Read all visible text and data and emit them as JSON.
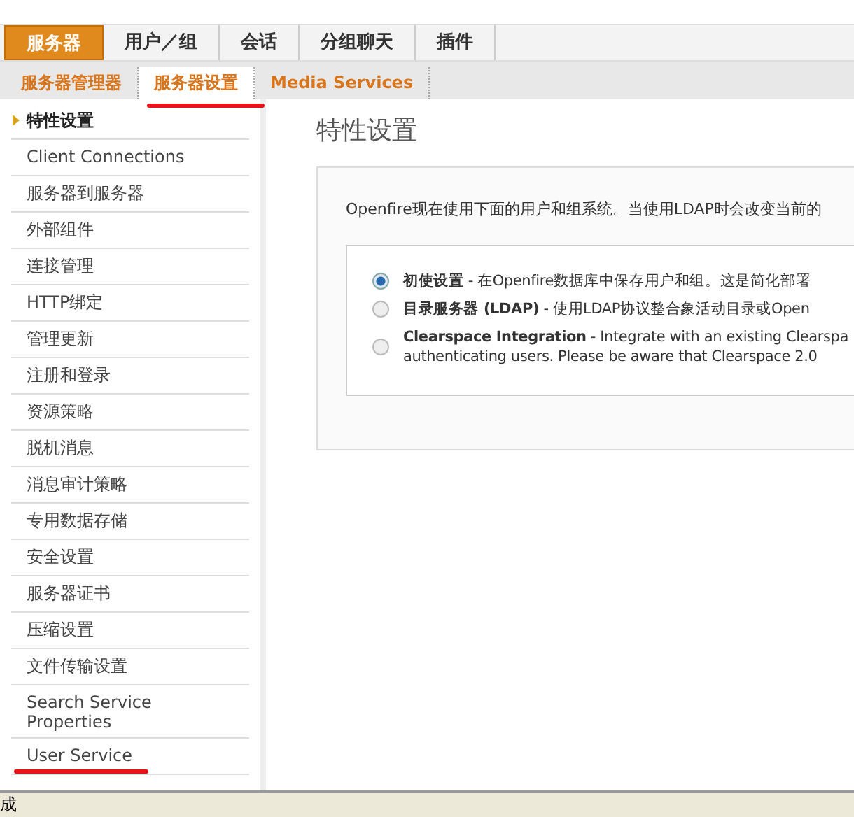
{
  "main_tabs": [
    {
      "label": "服务器",
      "selected": true
    },
    {
      "label": "用户／组",
      "selected": false
    },
    {
      "label": "会话",
      "selected": false
    },
    {
      "label": "分组聊天",
      "selected": false
    },
    {
      "label": "插件",
      "selected": false
    }
  ],
  "sub_tabs": [
    {
      "label": "服务器管理器",
      "selected": false,
      "underlined": false
    },
    {
      "label": "服务器设置",
      "selected": true,
      "underlined": true
    },
    {
      "label": "Media Services",
      "selected": false,
      "underlined": false
    }
  ],
  "sidebar": {
    "items": [
      {
        "label": "特性设置",
        "selected": true,
        "underlined": false
      },
      {
        "label": "Client Connections",
        "selected": false,
        "underlined": false
      },
      {
        "label": "服务器到服务器",
        "selected": false,
        "underlined": false
      },
      {
        "label": "外部组件",
        "selected": false,
        "underlined": false
      },
      {
        "label": "连接管理",
        "selected": false,
        "underlined": false
      },
      {
        "label": "HTTP绑定",
        "selected": false,
        "underlined": false
      },
      {
        "label": "管理更新",
        "selected": false,
        "underlined": false
      },
      {
        "label": "注册和登录",
        "selected": false,
        "underlined": false
      },
      {
        "label": "资源策略",
        "selected": false,
        "underlined": false
      },
      {
        "label": "脱机消息",
        "selected": false,
        "underlined": false
      },
      {
        "label": "消息审计策略",
        "selected": false,
        "underlined": false
      },
      {
        "label": "专用数据存储",
        "selected": false,
        "underlined": false
      },
      {
        "label": "安全设置",
        "selected": false,
        "underlined": false
      },
      {
        "label": "服务器证书",
        "selected": false,
        "underlined": false
      },
      {
        "label": "压缩设置",
        "selected": false,
        "underlined": false
      },
      {
        "label": "文件传输设置",
        "selected": false,
        "underlined": false
      },
      {
        "label": "Search Service Properties",
        "selected": false,
        "underlined": false
      },
      {
        "label": "User Service",
        "selected": false,
        "underlined": true
      }
    ]
  },
  "page_title": "特性设置",
  "intro": "Openfire现在使用下面的用户和组系统。当使用LDAP时会改变当前的",
  "options": [
    {
      "text": "**初使设置** - 在Openfire数据库中保存用户和组。这是简化部署",
      "selected": true
    },
    {
      "text": "**目录服务器 (LDAP)** - 使用LDAP协议整合象活动目录或Open",
      "selected": false
    },
    {
      "text": "**Clearspace Integration** - Integrate with an existing Clearspa\nauthenticating users. Please be aware that Clearspace 2.0",
      "selected": false
    }
  ],
  "status_bar": {
    "text": "成"
  }
}
